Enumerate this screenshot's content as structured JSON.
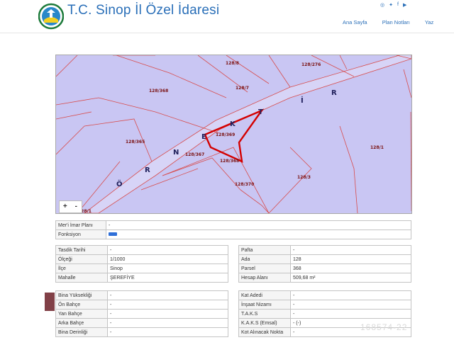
{
  "header": {
    "title": "T.C. Sinop İl Özel İdaresi",
    "nav": [
      "Ana Sayfa",
      "Plan Notları",
      "Yaz"
    ],
    "social_icons": [
      "instagram-icon",
      "twitter-icon",
      "facebook-icon",
      "youtube-icon"
    ],
    "social_glyphs": [
      "◎",
      "✦",
      "f",
      "▶"
    ]
  },
  "map": {
    "road_letters": [
      "Ö",
      "R",
      "N",
      "E",
      "K",
      "T",
      "İ",
      "R"
    ],
    "parcel_labels": [
      "128/8",
      "128/276",
      "128/368",
      "128/7",
      "128/369",
      "128/1",
      "128/365",
      "128/367",
      "128/368",
      "128/3",
      "128/370",
      "128/1"
    ],
    "zoom_in": "+",
    "zoom_out": "-",
    "colors": {
      "fill": "#c9c6f3",
      "lines": "#d84c4c",
      "highlight": "#d40000"
    }
  },
  "plan_table": [
    {
      "label": "Mer'i İmar Planı",
      "value": "-"
    },
    {
      "label": "Fonksiyon",
      "value": ""
    }
  ],
  "left_table": [
    {
      "label": "Tasdik Tarihi",
      "value": "-"
    },
    {
      "label": "Ölçeği",
      "value": "1/1000"
    },
    {
      "label": "İlçe",
      "value": "Sinop"
    },
    {
      "label": "Mahalle",
      "value": "ŞEREFİYE"
    }
  ],
  "right_table": [
    {
      "label": "Pafta",
      "value": "-"
    },
    {
      "label": "Ada",
      "value": "128"
    },
    {
      "label": "Parsel",
      "value": "368"
    },
    {
      "label": "Hesap Alanı",
      "value": "509,68 m²"
    }
  ],
  "left_table2": [
    {
      "label": "Bina Yüksekliği",
      "value": "-"
    },
    {
      "label": "Ön Bahçe",
      "value": "-"
    },
    {
      "label": "Yan Bahçe",
      "value": "-"
    },
    {
      "label": "Arka Bahçe",
      "value": "-"
    },
    {
      "label": "Bina Derinliği",
      "value": "-"
    }
  ],
  "right_table2": [
    {
      "label": "Kat Adedi",
      "value": "-"
    },
    {
      "label": "İnşaat Nizamı",
      "value": "-"
    },
    {
      "label": "T.A.K.S",
      "value": "-"
    },
    {
      "label": "K.A.K.S (Emsal)",
      "value": "- (-)"
    },
    {
      "label": "Kot Alınacak Nokta",
      "value": "-"
    }
  ],
  "watermark": "168574-22"
}
